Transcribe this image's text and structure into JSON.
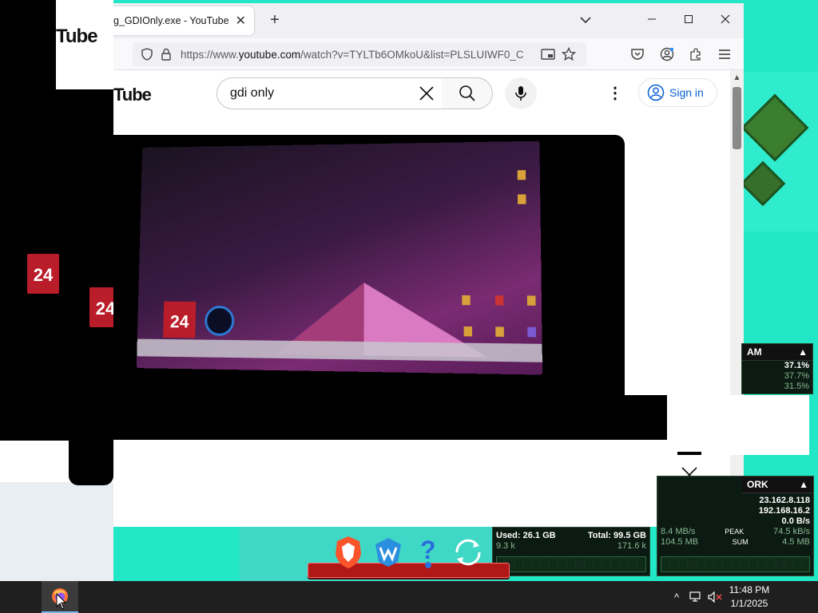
{
  "browser": {
    "tab_title": "g_GDIOnly.exe - YouTube",
    "tab_close": "✕",
    "new_tab": "+",
    "url_prefix": "https://www.",
    "url_domain": "youtube.com",
    "url_rest": "/watch?v=TYLTb6OMkoU&list=PLSLUIWF0_C",
    "window_buttons": {
      "list": "⌄",
      "minimize": "—",
      "maximize": "☐",
      "close": "✕"
    }
  },
  "youtube": {
    "logo_text": "Tube",
    "search_value": "gdi only",
    "signin_label": "Sign in"
  },
  "ghost": {
    "logo_text": "Tube",
    "cal_day": "24"
  },
  "video": {
    "cal_day": "24"
  },
  "widgets": {
    "ram": {
      "title": "AM",
      "value1": "37.1%",
      "value2": "37.7%",
      "value3": "31.5%"
    },
    "network": {
      "title": "ORK",
      "ip1": "23.162.8.118",
      "ip2": "192.168.16.2",
      "rate": "0.0 B/s",
      "peak_left": "8.4 MB/s",
      "peak_label": "PEAK",
      "peak_right": "74.5 kB/s",
      "sum_left": "104.5 MB",
      "sum_label": "SUM",
      "sum_right": "4.5 MB"
    },
    "disk": {
      "used": "Used: 26.1 GB",
      "total": "Total: 99.5 GB",
      "read": "9.3 k",
      "write": "171.6 k"
    }
  },
  "taskbar": {
    "time": "11:48 PM",
    "date": "1/1/2025",
    "chevron": "^"
  },
  "colors": {
    "desktop": "#22e7c6",
    "taskbar": "#1f1f1f",
    "accent": "#065fd4"
  }
}
